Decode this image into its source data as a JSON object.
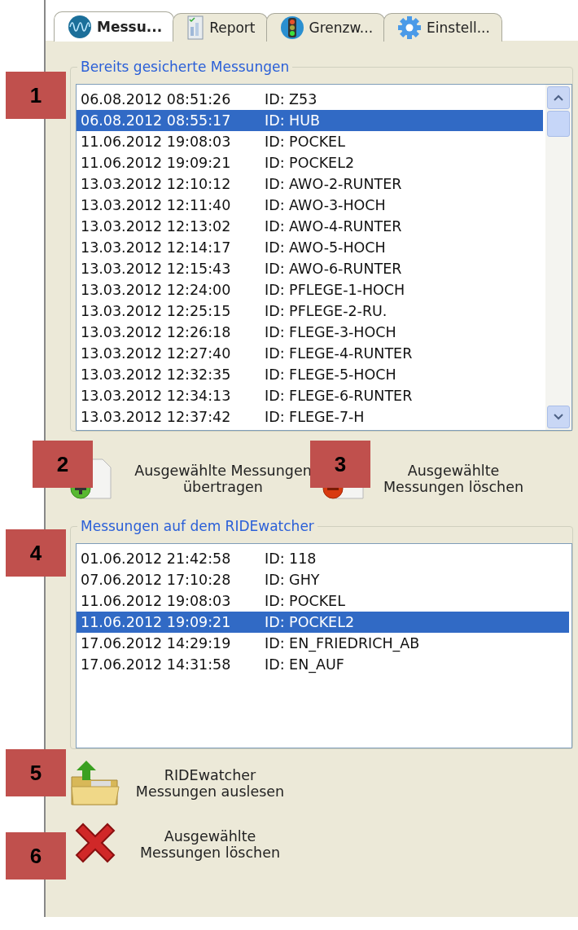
{
  "tabs": [
    {
      "label": "Messu...",
      "kind": "wave",
      "selected": true
    },
    {
      "label": "Report",
      "kind": "report",
      "selected": false
    },
    {
      "label": "Grenzw...",
      "kind": "light",
      "selected": false
    },
    {
      "label": "Einstell...",
      "kind": "gear",
      "selected": false
    }
  ],
  "saved_measurements": {
    "title": "Bereits gesicherte Messungen",
    "rows": [
      {
        "datetime": "06.08.2012 08:51:26",
        "id": "ID: Z53",
        "selected": false
      },
      {
        "datetime": "06.08.2012 08:55:17",
        "id": "ID: HUB",
        "selected": true
      },
      {
        "datetime": "11.06.2012 19:08:03",
        "id": "ID: POCKEL",
        "selected": false
      },
      {
        "datetime": "11.06.2012 19:09:21",
        "id": "ID: POCKEL2",
        "selected": false
      },
      {
        "datetime": "13.03.2012 12:10:12",
        "id": "ID: AWO-2-RUNTER",
        "selected": false
      },
      {
        "datetime": "13.03.2012 12:11:40",
        "id": "ID: AWO-3-HOCH",
        "selected": false
      },
      {
        "datetime": "13.03.2012 12:13:02",
        "id": "ID: AWO-4-RUNTER",
        "selected": false
      },
      {
        "datetime": "13.03.2012 12:14:17",
        "id": "ID: AWO-5-HOCH",
        "selected": false
      },
      {
        "datetime": "13.03.2012 12:15:43",
        "id": "ID: AWO-6-RUNTER",
        "selected": false
      },
      {
        "datetime": "13.03.2012 12:24:00",
        "id": "ID: PFLEGE-1-HOCH",
        "selected": false
      },
      {
        "datetime": "13.03.2012 12:25:15",
        "id": "ID: PFLEGE-2-RU.",
        "selected": false
      },
      {
        "datetime": "13.03.2012 12:26:18",
        "id": "ID: FLEGE-3-HOCH",
        "selected": false
      },
      {
        "datetime": "13.03.2012 12:27:40",
        "id": "ID: FLEGE-4-RUNTER",
        "selected": false
      },
      {
        "datetime": "13.03.2012 12:32:35",
        "id": "ID: FLEGE-5-HOCH",
        "selected": false
      },
      {
        "datetime": "13.03.2012 12:34:13",
        "id": "ID: FLEGE-6-RUNTER",
        "selected": false
      },
      {
        "datetime": "13.03.2012 12:37:42",
        "id": "ID: FLEGE-7-H",
        "selected": false
      }
    ],
    "actions": [
      {
        "label": "Ausgewählte Messungen übertragen",
        "kind": "add"
      },
      {
        "label": "Ausgewählte Messungen löschen",
        "kind": "remove"
      }
    ]
  },
  "device_measurements": {
    "title": "Messungen auf dem RIDEwatcher",
    "rows": [
      {
        "datetime": "01.06.2012 21:42:58",
        "id": "ID: 118",
        "selected": false
      },
      {
        "datetime": "07.06.2012 17:10:28",
        "id": "ID: GHY",
        "selected": false
      },
      {
        "datetime": "11.06.2012 19:08:03",
        "id": "ID: POCKEL",
        "selected": false
      },
      {
        "datetime": "11.06.2012 19:09:21",
        "id": "ID: POCKEL2",
        "selected": true
      },
      {
        "datetime": "17.06.2012 14:29:19",
        "id": "ID: EN_FRIEDRICH_AB",
        "selected": false
      },
      {
        "datetime": "17.06.2012 14:31:58",
        "id": "ID: EN_AUF",
        "selected": false
      }
    ],
    "actions": [
      {
        "label": "RIDEwatcher Messungen auslesen",
        "kind": "folder"
      },
      {
        "label": "Ausgewählte Messungen löschen",
        "kind": "cross"
      }
    ]
  },
  "callouts": [
    "1",
    "2",
    "3",
    "4",
    "5",
    "6"
  ]
}
